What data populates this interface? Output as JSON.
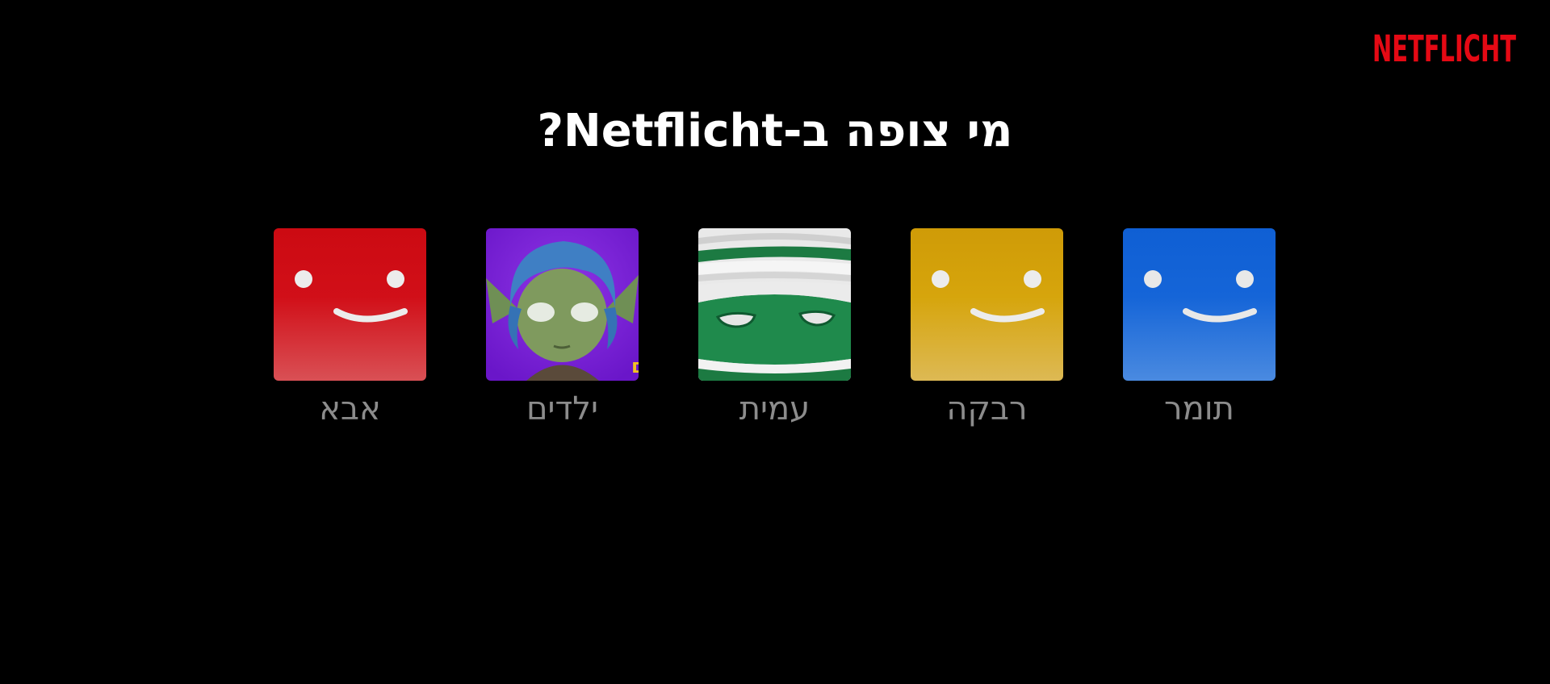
{
  "brand": {
    "logo_text": "NETFLICHT",
    "color": "#e50914"
  },
  "heading": {
    "title": "מי צופה ב-Netflicht?"
  },
  "profiles": [
    {
      "name": "תומר",
      "avatar": "smiley-blue-icon",
      "color": "#1565d8"
    },
    {
      "name": "רבקה",
      "avatar": "smiley-yellow-icon",
      "color": "#d6a50c"
    },
    {
      "name": "עמית",
      "avatar": "mummy-face-icon",
      "color": "#1f8a4c"
    },
    {
      "name": "ילדים",
      "avatar": "kids-goblin-icon",
      "color": "#7b1fd6",
      "badge": "ילדים"
    },
    {
      "name": "אבא",
      "avatar": "smiley-red-icon",
      "color": "#d10f18"
    }
  ]
}
